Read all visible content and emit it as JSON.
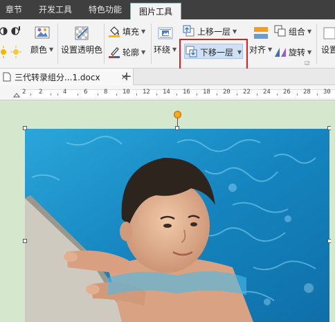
{
  "menu": {
    "tabs": [
      "章节",
      "开发工具",
      "特色功能",
      "图片工具"
    ]
  },
  "ribbon": {
    "color_label": "颜色",
    "transparent_label": "设置透明色",
    "fill_label": "填充",
    "outline_label": "轮廓",
    "wrap_label": "环绕",
    "bring_forward_label": "上移一层",
    "send_backward_label": "下移一层",
    "align_label": "对齐",
    "group_label": "组合",
    "rotate_label": "旋转",
    "settings_label": "设置"
  },
  "documents": {
    "tabs": [
      {
        "title": "三代转录组分...1.docx"
      }
    ],
    "new_tab": "+"
  },
  "ruler": {
    "labels": [
      "2",
      "2",
      "4",
      "6",
      "8",
      "10",
      "12",
      "14",
      "16",
      "18",
      "20",
      "22",
      "24",
      "26",
      "28",
      "30"
    ]
  },
  "colors": {
    "highlight_border": "#e02020",
    "active_tab_bg": "#f3f3f3",
    "page_bg": "#d5e8cd",
    "water": "#1b8fc5"
  }
}
